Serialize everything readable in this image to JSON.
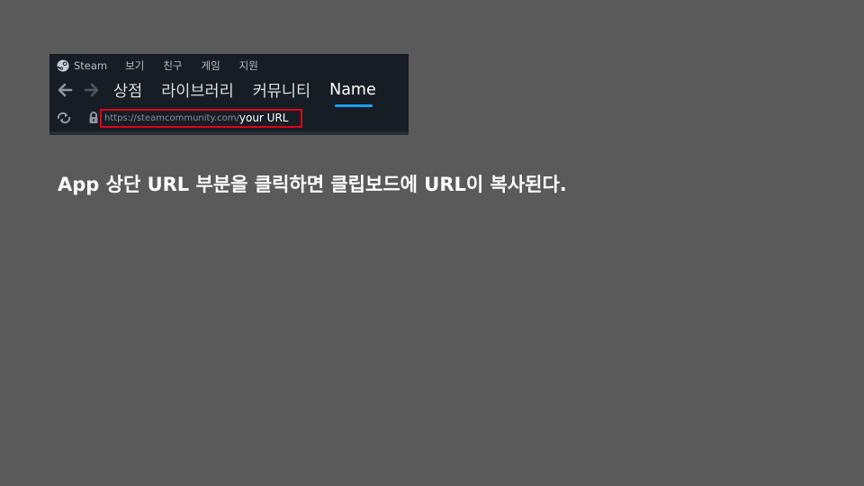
{
  "menu": {
    "brand": "Steam",
    "items": [
      "보기",
      "친구",
      "게임",
      "지원"
    ]
  },
  "nav": {
    "tabs": [
      "상점",
      "라이브러리",
      "커뮤니티",
      "Name"
    ],
    "active_tab": "Name"
  },
  "address": {
    "base_url": "https://steamcommunity.com/",
    "path": "your URL"
  },
  "caption": "App 상단 URL 부분을 클릭하면 클립보드에 URL이 복사된다.",
  "colors": {
    "background": "#5a5a5a",
    "steam_bg": "#171d25",
    "highlight_box": "#e0001a",
    "active_underline": "#1a9fff"
  },
  "icons": [
    "steam-logo-icon",
    "back-arrow-icon",
    "forward-arrow-icon",
    "refresh-icon",
    "lock-icon"
  ]
}
